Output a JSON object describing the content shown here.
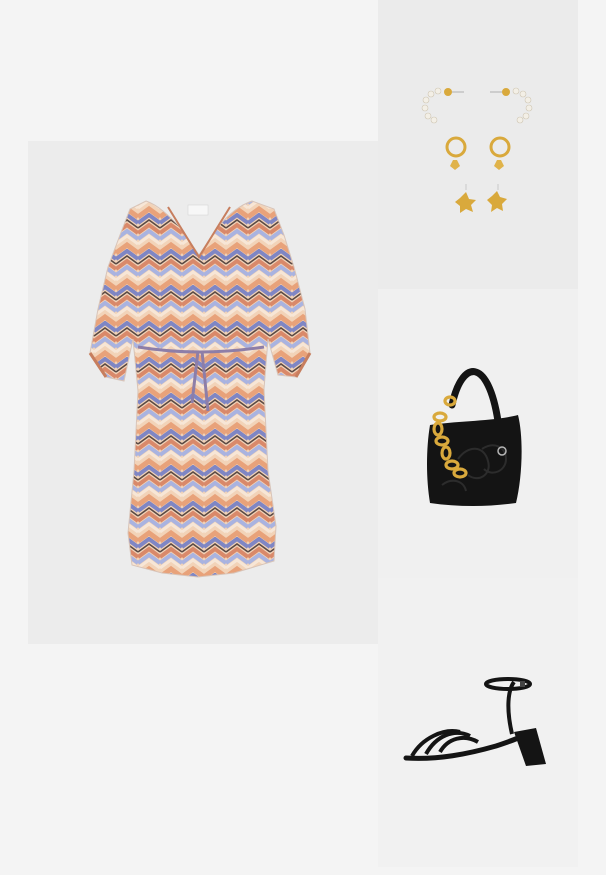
{
  "products": [
    {
      "id": "dress",
      "icon": "zigzag-print-dress-image"
    },
    {
      "id": "earrings",
      "icon": "earring-set-image"
    },
    {
      "id": "bag",
      "icon": "black-shoulder-bag-image"
    },
    {
      "id": "sandal",
      "icon": "black-block-heel-sandal-image"
    }
  ],
  "colors": {
    "page_background": "#f4f4f4",
    "dress_zigzag": [
      "#e8a27a",
      "#7f86c4",
      "#f2d3b8",
      "#5b4a44",
      "#d9896a",
      "#a9b3e0"
    ],
    "gold": "#d9a93c",
    "pearl": "#f3efe6",
    "black": "#141414"
  }
}
